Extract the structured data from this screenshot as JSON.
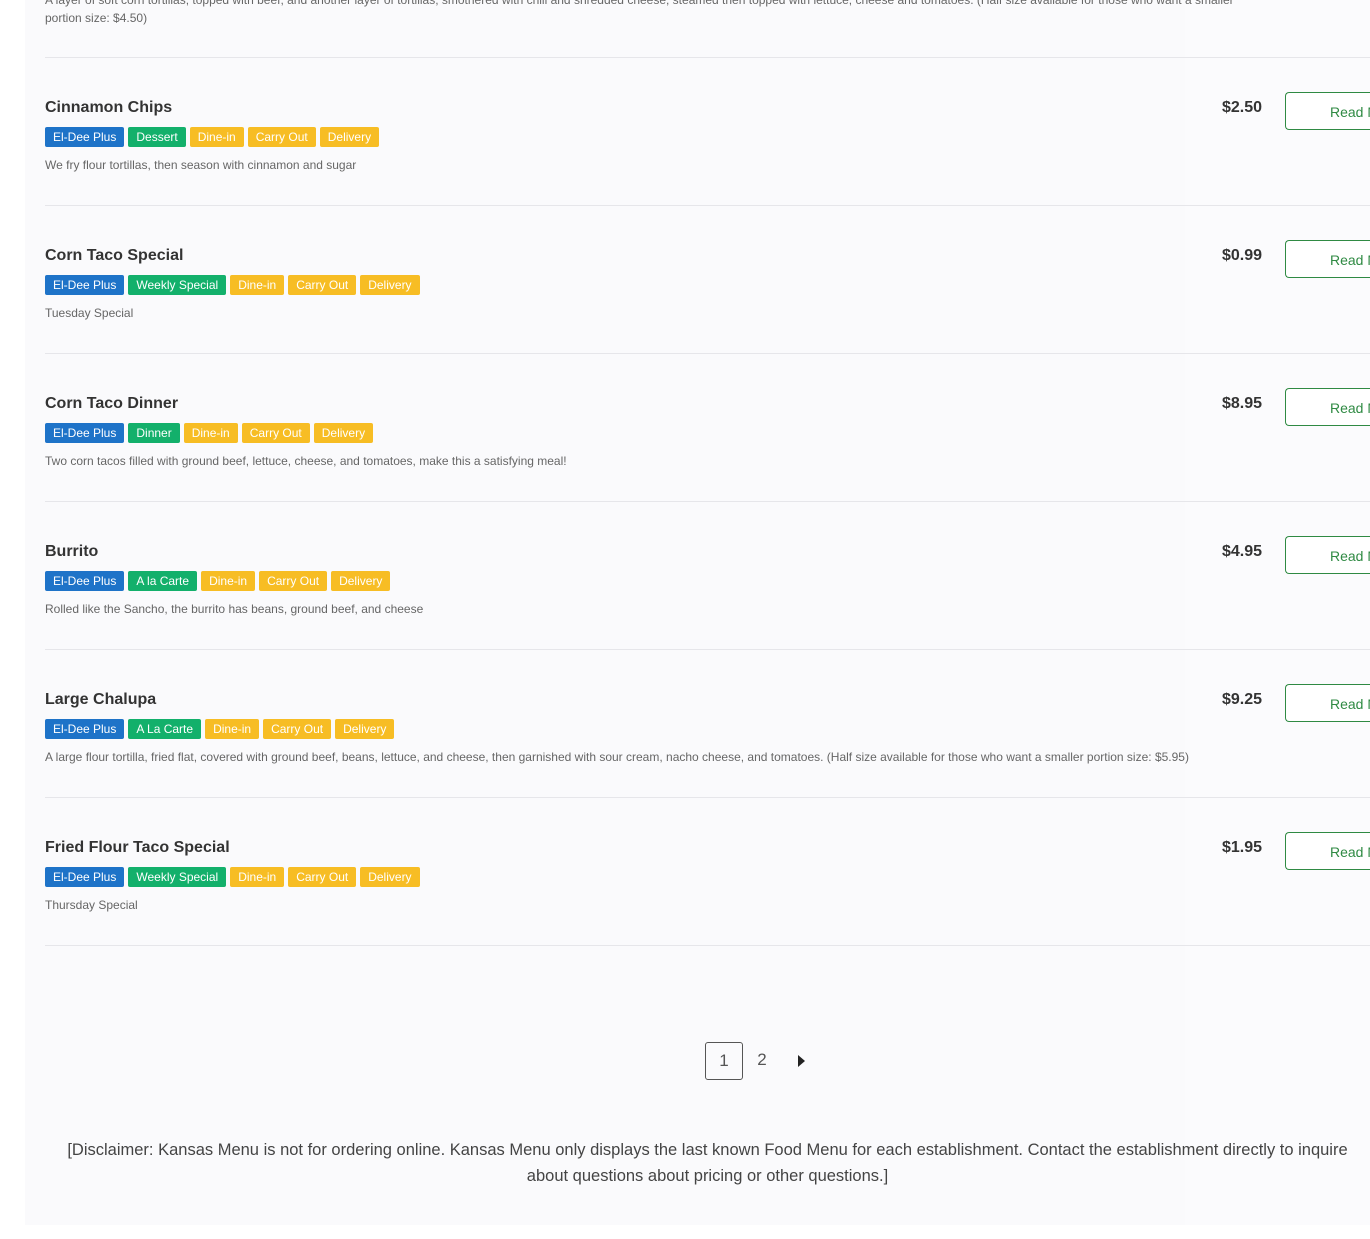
{
  "top_desc": "A layer of soft corn tortillas, topped with beef, and another layer of tortillas, smothered with chili and shredded cheese, steamed then topped with lettuce, cheese and tomatoes. (Half size available for those who want a smaller portion size: $4.50)",
  "items": [
    {
      "name": "Cinnamon Chips",
      "price": "$2.50",
      "tags": [
        {
          "label": "El-Dee Plus",
          "color": "blue"
        },
        {
          "label": "Dessert",
          "color": "green"
        },
        {
          "label": "Dine-in",
          "color": "yellow"
        },
        {
          "label": "Carry Out",
          "color": "yellow"
        },
        {
          "label": "Delivery",
          "color": "yellow"
        }
      ],
      "description": "We fry flour tortillas, then season with cinnamon and sugar",
      "button": "Read M"
    },
    {
      "name": "Corn Taco Special",
      "price": "$0.99",
      "tags": [
        {
          "label": "El-Dee Plus",
          "color": "blue"
        },
        {
          "label": "Weekly Special",
          "color": "green"
        },
        {
          "label": "Dine-in",
          "color": "yellow"
        },
        {
          "label": "Carry Out",
          "color": "yellow"
        },
        {
          "label": "Delivery",
          "color": "yellow"
        }
      ],
      "description": "Tuesday Special",
      "button": "Read M"
    },
    {
      "name": "Corn Taco Dinner",
      "price": "$8.95",
      "tags": [
        {
          "label": "El-Dee Plus",
          "color": "blue"
        },
        {
          "label": "Dinner",
          "color": "green"
        },
        {
          "label": "Dine-in",
          "color": "yellow"
        },
        {
          "label": "Carry Out",
          "color": "yellow"
        },
        {
          "label": "Delivery",
          "color": "yellow"
        }
      ],
      "description": "Two corn tacos filled with ground beef, lettuce, cheese, and tomatoes, make this a satisfying meal!",
      "button": "Read M"
    },
    {
      "name": "Burrito",
      "price": "$4.95",
      "tags": [
        {
          "label": "El-Dee Plus",
          "color": "blue"
        },
        {
          "label": "A la Carte",
          "color": "green"
        },
        {
          "label": "Dine-in",
          "color": "yellow"
        },
        {
          "label": "Carry Out",
          "color": "yellow"
        },
        {
          "label": "Delivery",
          "color": "yellow"
        }
      ],
      "description": "Rolled like the Sancho, the burrito has beans, ground beef, and cheese",
      "button": "Read M"
    },
    {
      "name": "Large Chalupa",
      "price": "$9.25",
      "tags": [
        {
          "label": "El-Dee Plus",
          "color": "blue"
        },
        {
          "label": "A La Carte",
          "color": "green"
        },
        {
          "label": "Dine-in",
          "color": "yellow"
        },
        {
          "label": "Carry Out",
          "color": "yellow"
        },
        {
          "label": "Delivery",
          "color": "yellow"
        }
      ],
      "description": "A large flour tortilla, fried flat, covered with ground beef, beans, lettuce, and cheese, then garnished with sour cream, nacho cheese, and tomatoes. (Half size available for those who want a smaller portion size: $5.95)",
      "button": "Read M"
    },
    {
      "name": "Fried Flour Taco Special",
      "price": "$1.95",
      "tags": [
        {
          "label": "El-Dee Plus",
          "color": "blue"
        },
        {
          "label": "Weekly Special",
          "color": "green"
        },
        {
          "label": "Dine-in",
          "color": "yellow"
        },
        {
          "label": "Carry Out",
          "color": "yellow"
        },
        {
          "label": "Delivery",
          "color": "yellow"
        }
      ],
      "description": "Thursday Special",
      "button": "Read M"
    }
  ],
  "pagination": {
    "pages": [
      "1",
      "2"
    ],
    "current": "1",
    "next_icon": "caret-right-icon"
  },
  "disclaimer": "[Disclaimer: Kansas Menu is not for ordering online. Kansas Menu only displays the last known Food Menu for each establishment. Contact the establishment directly to inquire about questions about pricing or other questions.]",
  "colors": {
    "blue": "#1e73c8",
    "green": "#13b06b",
    "yellow": "#f7bd24",
    "button": "#2f8a43"
  }
}
